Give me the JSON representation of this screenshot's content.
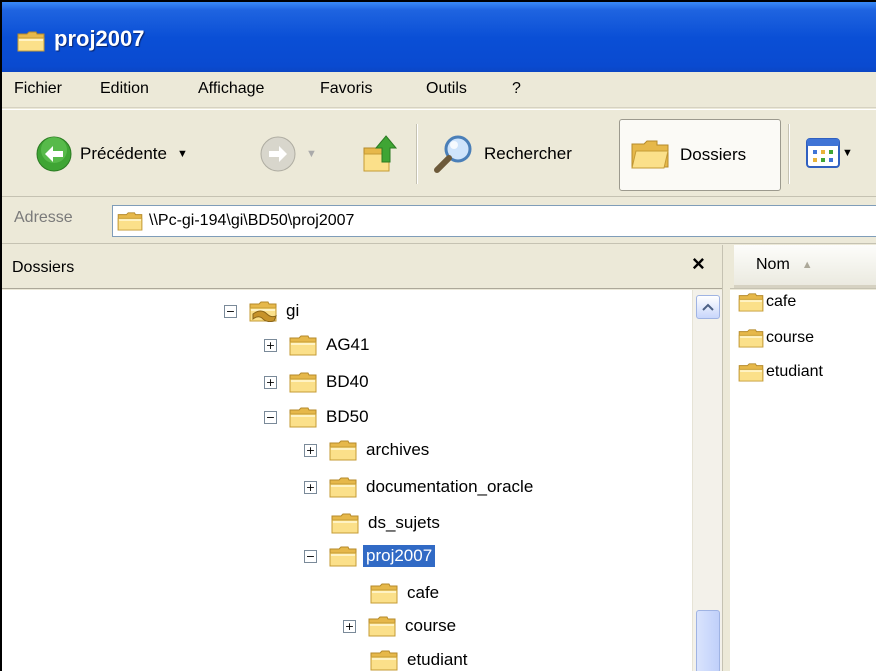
{
  "window": {
    "title": "proj2007"
  },
  "menu": [
    "Fichier",
    "Edition",
    "Affichage",
    "Favoris",
    "Outils",
    "?"
  ],
  "toolbar": {
    "back_label": "Précédente",
    "search_label": "Rechercher",
    "folders_label": "Dossiers"
  },
  "address": {
    "label": "Adresse",
    "path": "\\\\Pc-gi-194\\gi\\BD50\\proj2007"
  },
  "folders_pane": {
    "title": "Dossiers",
    "close": "×",
    "tree": [
      {
        "label": "gi",
        "expander": "−",
        "icon": "shared-folder-icon"
      },
      {
        "label": "AG41",
        "expander": "+"
      },
      {
        "label": "BD40",
        "expander": "+"
      },
      {
        "label": "BD50",
        "expander": "−"
      },
      {
        "label": "archives",
        "expander": "+"
      },
      {
        "label": "documentation_oracle",
        "expander": "+"
      },
      {
        "label": "ds_sujets",
        "expander": ""
      },
      {
        "label": "proj2007",
        "expander": "−",
        "selected": true
      },
      {
        "label": "cafe",
        "expander": ""
      },
      {
        "label": "course",
        "expander": "+"
      },
      {
        "label": "etudiant",
        "expander": ""
      }
    ]
  },
  "file_list": {
    "column_name": "Nom",
    "items": [
      "cafe",
      "course",
      "etudiant"
    ]
  },
  "colors": {
    "titlebar": "#0a4fd6",
    "selection": "#316ac5",
    "folder": "#f4d46a"
  }
}
